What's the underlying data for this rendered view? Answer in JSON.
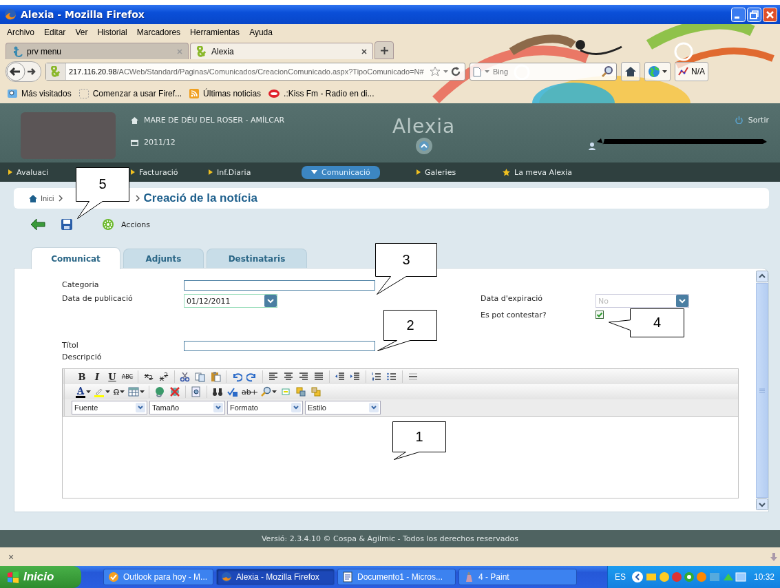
{
  "window": {
    "title": "Alexia - Mozilla Firefox"
  },
  "menu_bar": [
    "Archivo",
    "Editar",
    "Ver",
    "Historial",
    "Marcadores",
    "Herramientas",
    "Ayuda"
  ],
  "browser_tabs": [
    {
      "label": "prv menu",
      "selected": false
    },
    {
      "label": "Alexia",
      "selected": true
    }
  ],
  "address_bar": {
    "host": "217.116.20.98",
    "path": "/ACWeb/Standard/Paginas/Comunicados/CreacionComunicado.aspx?TipoComunicado=N#"
  },
  "search_bar": {
    "placeholder": "Bing"
  },
  "addon_label": "N/A",
  "bookmarks": [
    "Más visitados",
    "Comenzar a usar Firef...",
    "Últimas noticias",
    ".:Kiss Fm - Radio en di..."
  ],
  "app_header": {
    "school": "MARE DE DÉU DEL ROSER - AMÍLCAR",
    "year": "2011/12",
    "logo": "Alexia",
    "logout": "Sortir"
  },
  "main_nav": [
    {
      "label": "Avaluaci",
      "kind": "section",
      "selected": false
    },
    {
      "label": "Facturació",
      "kind": "section",
      "selected": false
    },
    {
      "label": "Inf.Diaria",
      "kind": "section",
      "selected": false
    },
    {
      "label": "Comunicació",
      "kind": "section",
      "selected": true
    },
    {
      "label": "Galeries",
      "kind": "section",
      "selected": false
    },
    {
      "label": "La meva Alexia",
      "kind": "favorite",
      "selected": false
    }
  ],
  "breadcrumb": {
    "home": "Inici",
    "current": "Creació de la notícia"
  },
  "toolbar": {
    "actions": "Accions"
  },
  "form_tabs": [
    {
      "label": "Comunicat",
      "selected": true
    },
    {
      "label": "Adjunts",
      "selected": false
    },
    {
      "label": "Destinataris",
      "selected": false
    }
  ],
  "form": {
    "category_label": "Categoria",
    "publication_date": {
      "label": "Data de publicació",
      "value": "01/12/2011"
    },
    "expiry_date": {
      "label": "Data d'expiració",
      "value": "No"
    },
    "can_reply": {
      "label": "Es pot contestar?",
      "checked": true
    },
    "title_label": "Títol",
    "description_label": "Descripció"
  },
  "editor": {
    "toolbar_row_1": [
      {
        "kind": "glyph",
        "label": "B"
      },
      {
        "kind": "glyph",
        "label": "I"
      },
      {
        "kind": "glyph",
        "label": "U"
      },
      {
        "kind": "glyph",
        "label": "ABC"
      },
      {
        "kind": "separator"
      },
      {
        "kind": "glyph",
        "label": "x$_{2}$"
      },
      {
        "kind": "glyph",
        "label": "x$^{2}$"
      },
      {
        "kind": "separator"
      },
      {
        "kind": "icon"
      },
      {
        "kind": "icon"
      },
      {
        "kind": "icon"
      },
      {
        "kind": "separator"
      },
      {
        "kind": "icon"
      },
      {
        "kind": "icon"
      },
      {
        "kind": "separator"
      },
      {
        "kind": "icon"
      },
      {
        "kind": "icon"
      },
      {
        "kind": "icon"
      },
      {
        "kind": "icon"
      },
      {
        "kind": "separator"
      },
      {
        "kind": "icon"
      },
      {
        "kind": "icon"
      },
      {
        "kind": "separator"
      },
      {
        "kind": "icon"
      },
      {
        "kind": "icon"
      },
      {
        "kind": "separator"
      },
      {
        "kind": "icon"
      }
    ],
    "toolbar_row_2": [
      {
        "kind": "swatch",
        "label": "A",
        "color": "#000000",
        "dropdown": true
      },
      {
        "kind": "swatch",
        "color": "#ffff00",
        "dropdown": true
      },
      {
        "kind": "glyph",
        "label": "Ω",
        "dropdown": true
      },
      {
        "kind": "icon",
        "dropdown": true
      },
      {
        "kind": "separator"
      },
      {
        "kind": "icon"
      },
      {
        "kind": "icon"
      },
      {
        "kind": "separator"
      },
      {
        "kind": "icon"
      },
      {
        "kind": "separator"
      },
      {
        "kind": "icon"
      },
      {
        "kind": "icon"
      },
      {
        "kind": "glyph",
        "label": "ab+"
      },
      {
        "kind": "icon",
        "dropdown": true
      },
      {
        "kind": "icon"
      },
      {
        "kind": "icon"
      },
      {
        "kind": "icon"
      }
    ],
    "dropdowns": [
      "Fuente",
      "Tamaño",
      "Formato",
      "Estilo"
    ]
  },
  "footer": "Versió: 2.3.4.10 © Cospa & Agilmic - Todos los derechos reservados",
  "status_bar": {
    "close": "×"
  },
  "taskbar": {
    "start": "Inicio",
    "tasks": [
      {
        "label": "Outlook para hoy - M...",
        "selected": false
      },
      {
        "label": "Alexia - Mozilla Firefox",
        "selected": true
      },
      {
        "label": "Documento1 - Micros...",
        "selected": false
      },
      {
        "label": "4 - Paint",
        "selected": false
      }
    ],
    "language": "ES",
    "clock": "10:32"
  },
  "callouts": [
    "5",
    "3",
    "2",
    "4",
    "1"
  ]
}
